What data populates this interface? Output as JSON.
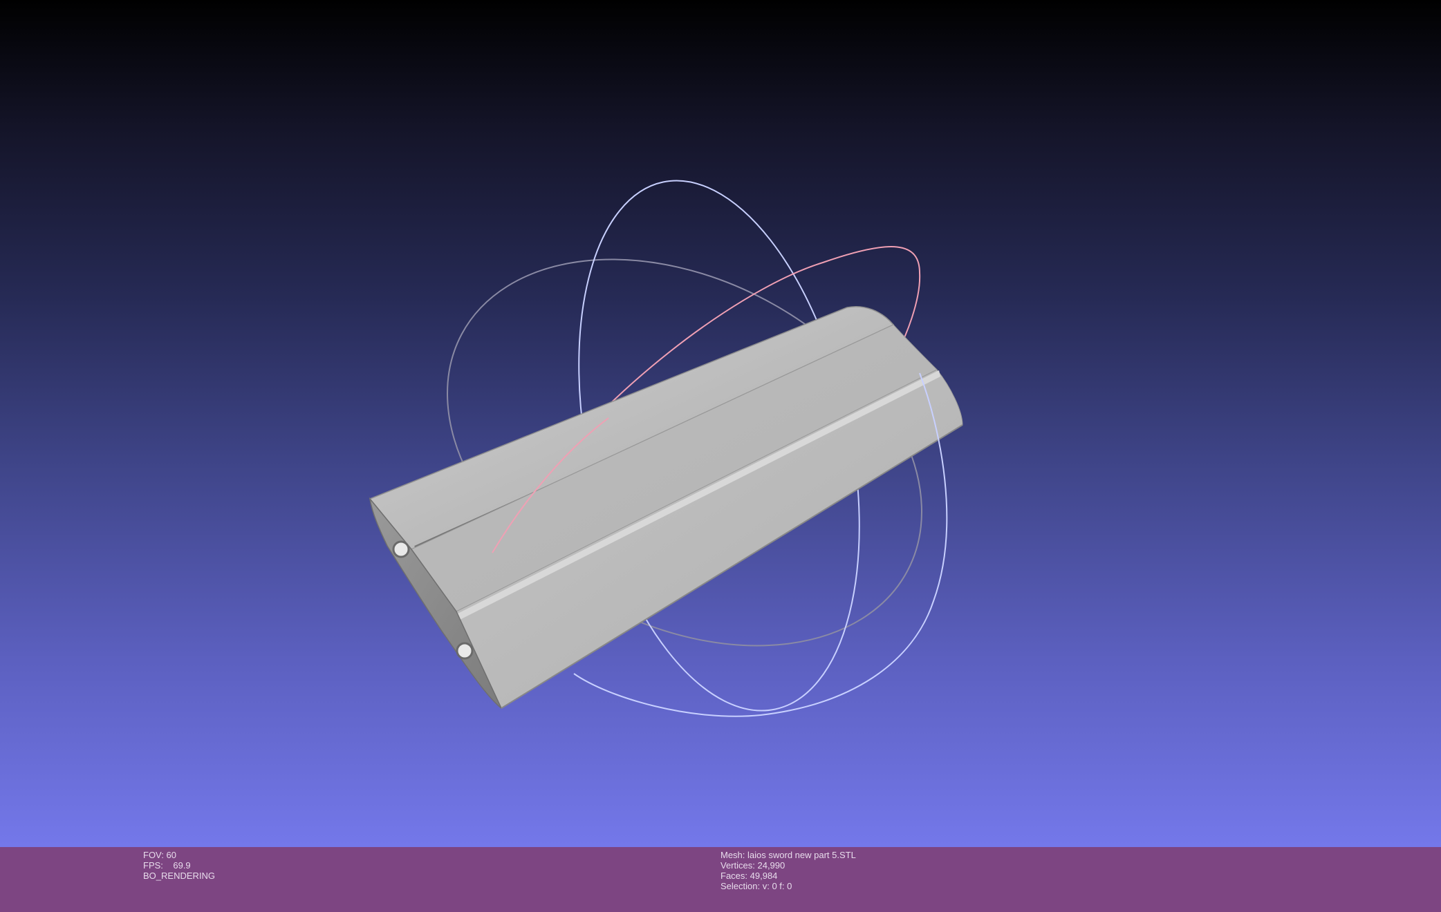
{
  "viewer": {
    "stats_left": {
      "fov_label": "FOV:",
      "fov_value": "60",
      "fps_label": "FPS:",
      "fps_value": "69.9",
      "mode": "BO_RENDERING"
    },
    "stats_right": {
      "mesh_label": "Mesh:",
      "mesh_value": "laios sword new part 5.STL",
      "vertices_label": "Vertices:",
      "vertices_value": "24,990",
      "faces_label": "Faces:",
      "faces_value": "49,984",
      "selection_label": "Selection:",
      "selection_value": "v: 0 f: 0"
    },
    "colors": {
      "viewport_top": "#000000",
      "viewport_bottom": "#7478ea",
      "info_bar": "#7d4582",
      "mesh": "#bdbdbd",
      "trackball_x": "#f0a0b4",
      "trackball_y": "#c8d0ff",
      "trackball_z": "#9090a8"
    },
    "icons": [
      "trackball-gizmo"
    ]
  }
}
